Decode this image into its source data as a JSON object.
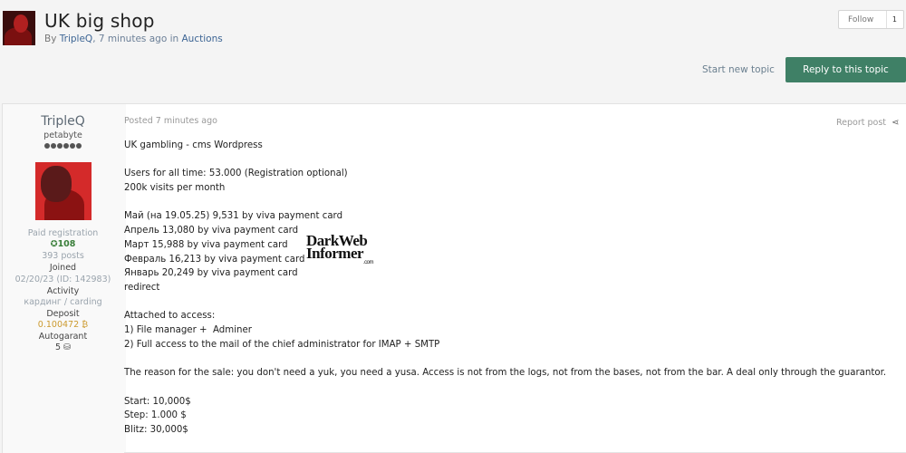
{
  "topic": {
    "title": "UK big shop",
    "by_prefix": "By ",
    "author": "TripleQ",
    "time": ", 7 minutes ago",
    "in_text": " in ",
    "forum": "Auctions"
  },
  "actions": {
    "follow_label": "Follow",
    "follow_count": "1",
    "start_topic": "Start new topic",
    "reply": "Reply to this topic"
  },
  "author": {
    "name": "TripleQ",
    "rank": "petabyte",
    "group": "Paid registration",
    "reputation": "108",
    "posts": "393 posts",
    "joined_label": "Joined",
    "joined_value": "02/20/23 (ID: 142983)",
    "activity_label": "Activity",
    "activity_value": "кардинг / carding",
    "deposit_label": "Deposit",
    "deposit_value": "0.100472 ₿",
    "autogarant_label": "Autogarant",
    "autogarant_value": "5"
  },
  "post": {
    "posted": "Posted 7 minutes ago",
    "report": "Report post",
    "lines": [
      "UK gambling - cms Wordpress",
      "",
      "Users for all time: 53.000 (Registration optional)",
      "200k visits per month",
      "",
      "Май (на 19.05.25) 9,531 by viva payment card",
      "Апрель 13,080 by viva payment card",
      "Март 15,988 by viva payment card",
      "Февраль 16,213 by viva payment card",
      "Январь 20,249 by viva payment card",
      "redirect",
      "",
      "Attached to access:",
      "1) File manager +  Adminer",
      "2) Full access to the mail of the chief administrator for IMAP + SMTP",
      "",
      "The reason for the sale: you don't need a yuk, you need a yusa. Access is not from the logs, not from the bases, not from the bar. A deal only through the guarantor.",
      "",
      "Start: 10,000$",
      "Step: 1.000 $",
      "Blitz: 30,000$"
    ]
  },
  "watermark": {
    "line1": "DarkWeb",
    "line2": "Informer",
    "line3": ".com"
  },
  "icons": {
    "reputation": "plus-circle-icon",
    "autogarant": "handshake-icon",
    "share": "share-icon"
  }
}
